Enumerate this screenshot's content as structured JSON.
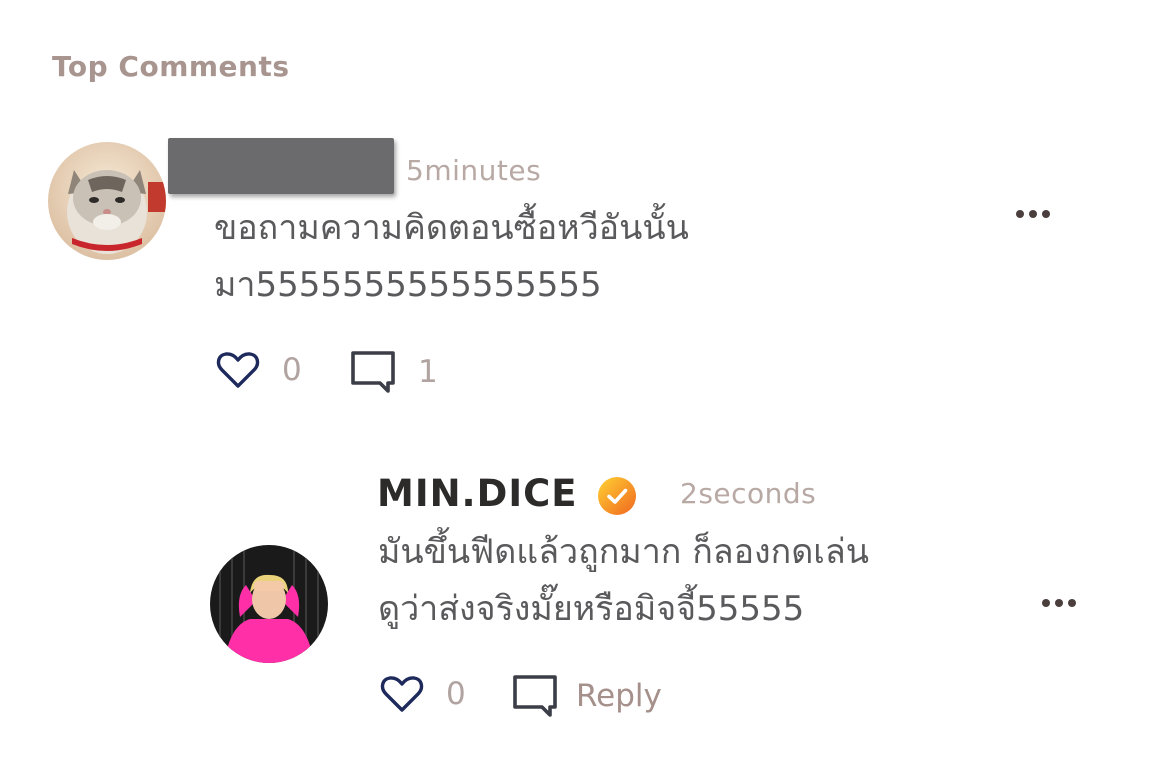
{
  "section_title": "Top Comments",
  "comments": [
    {
      "author": "",
      "avatar_icon": "cat-avatar-icon",
      "timestamp": "5minutes",
      "text_lines": [
        "ขอถามความคิดตอนซื้อหวีอันนั้น",
        "มา5555555555555555"
      ],
      "likes": "0",
      "replies": "1"
    },
    {
      "author": "MIN.DICE",
      "verified": true,
      "avatar_icon": "user-avatar-icon",
      "timestamp": "2seconds",
      "text_lines": [
        "มันขึ้นฟีดแล้วถูกมาก ก็ลองกดเล่น",
        "ดูว่าส่งจริงมั๊ยหรือมิจจี้55555"
      ],
      "likes": "0",
      "reply_label": "Reply"
    }
  ],
  "colors": {
    "section_title": "#a89590",
    "timestamp": "#b8a9a4",
    "heart_outline": "#1f2a5c",
    "verified_badge": "#f5a623"
  }
}
